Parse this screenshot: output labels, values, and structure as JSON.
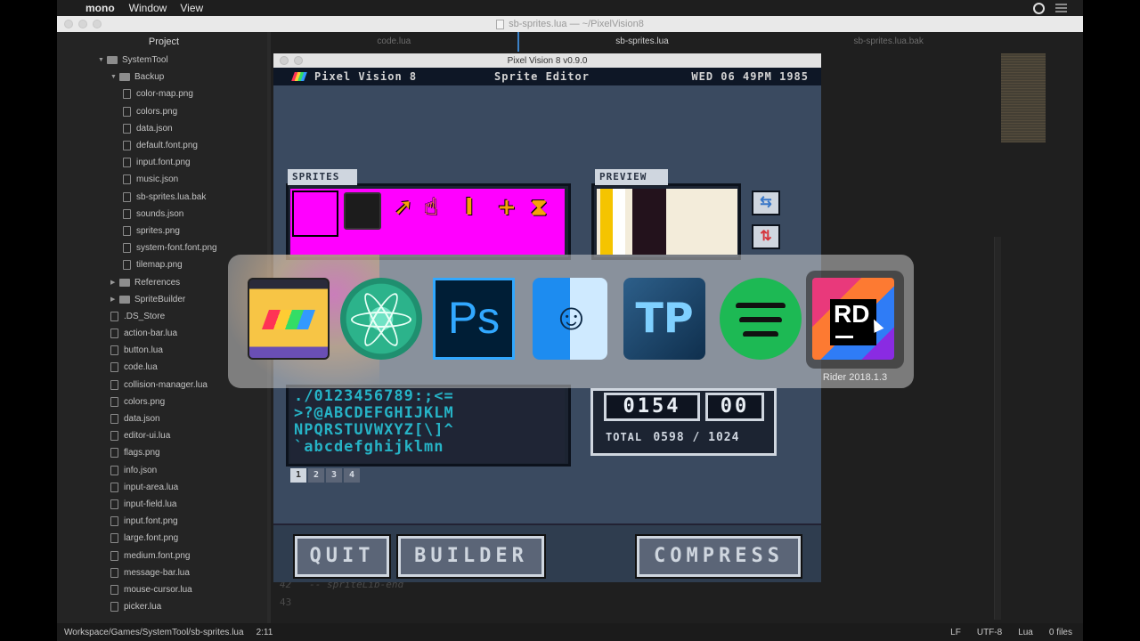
{
  "menubar": {
    "app_name": "mono",
    "items": [
      "Window",
      "View"
    ]
  },
  "window": {
    "title": "sb-sprites.lua — ~/PixelVision8"
  },
  "sidebar": {
    "header": "Project",
    "tree": [
      {
        "label": "SystemTool",
        "type": "folder",
        "depth": 0,
        "expanded": true
      },
      {
        "label": "Backup",
        "type": "folder",
        "depth": 1,
        "expanded": true
      },
      {
        "label": "color-map.png",
        "type": "file",
        "depth": 2
      },
      {
        "label": "colors.png",
        "type": "file",
        "depth": 2
      },
      {
        "label": "data.json",
        "type": "file",
        "depth": 2
      },
      {
        "label": "default.font.png",
        "type": "file",
        "depth": 2
      },
      {
        "label": "input.font.png",
        "type": "file",
        "depth": 2
      },
      {
        "label": "music.json",
        "type": "file",
        "depth": 2
      },
      {
        "label": "sb-sprites.lua.bak",
        "type": "file",
        "depth": 2
      },
      {
        "label": "sounds.json",
        "type": "file",
        "depth": 2
      },
      {
        "label": "sprites.png",
        "type": "file",
        "depth": 2
      },
      {
        "label": "system-font.font.png",
        "type": "file",
        "depth": 2
      },
      {
        "label": "tilemap.png",
        "type": "file",
        "depth": 2
      },
      {
        "label": "References",
        "type": "folder",
        "depth": 1,
        "expanded": false
      },
      {
        "label": "SpriteBuilder",
        "type": "folder",
        "depth": 1,
        "expanded": false
      },
      {
        "label": ".DS_Store",
        "type": "file",
        "depth": 1
      },
      {
        "label": "action-bar.lua",
        "type": "file",
        "depth": 1
      },
      {
        "label": "button.lua",
        "type": "file",
        "depth": 1
      },
      {
        "label": "code.lua",
        "type": "file",
        "depth": 1
      },
      {
        "label": "collision-manager.lua",
        "type": "file",
        "depth": 1
      },
      {
        "label": "colors.png",
        "type": "file",
        "depth": 1
      },
      {
        "label": "data.json",
        "type": "file",
        "depth": 1
      },
      {
        "label": "editor-ui.lua",
        "type": "file",
        "depth": 1
      },
      {
        "label": "flags.png",
        "type": "file",
        "depth": 1
      },
      {
        "label": "info.json",
        "type": "file",
        "depth": 1
      },
      {
        "label": "input-area.lua",
        "type": "file",
        "depth": 1
      },
      {
        "label": "input-field.lua",
        "type": "file",
        "depth": 1
      },
      {
        "label": "input.font.png",
        "type": "file",
        "depth": 1
      },
      {
        "label": "large.font.png",
        "type": "file",
        "depth": 1
      },
      {
        "label": "medium.font.png",
        "type": "file",
        "depth": 1
      },
      {
        "label": "message-bar.lua",
        "type": "file",
        "depth": 1
      },
      {
        "label": "mouse-cursor.lua",
        "type": "file",
        "depth": 1
      },
      {
        "label": "picker.lua",
        "type": "file",
        "depth": 1
      }
    ]
  },
  "tabs": [
    {
      "label": "code.lua",
      "active": false
    },
    {
      "label": "sb-sprites.lua",
      "active": true
    },
    {
      "label": "sb-sprites.lua.bak",
      "active": false
    }
  ],
  "code": {
    "line42_num": "42",
    "line42_text": "-- spriteLib-end",
    "line43_num": "43"
  },
  "statusbar": {
    "path": "Workspace/Games/SystemTool/sb-sprites.lua",
    "position": "2:11",
    "line_ending": "LF",
    "encoding": "UTF-8",
    "language": "Lua",
    "files": "0 files"
  },
  "pv8": {
    "window_title": "Pixel Vision 8 v0.9.0",
    "brand": "Pixel Vision 8",
    "tool_name": "Sprite Editor",
    "datetime": "WED 06 49PM 1985",
    "sprites_label": "SPRITES",
    "preview_label": "PREVIEW",
    "font_rows": [
      "./0123456789:;<=",
      ">?@ABCDEFGHIJKLM",
      "NPQRSTUVWXYZ[\\]^",
      "`abcdefghijklmn"
    ],
    "pages": [
      "1",
      "2",
      "3",
      "4"
    ],
    "active_page": "1",
    "sprite_id": "0154",
    "color_offset": "00",
    "total_label": "TOTAL",
    "total_value": "0598 / 1024",
    "buttons": {
      "quit": "QUIT",
      "builder": "BUILDER",
      "compress": "COMPRESS"
    }
  },
  "app_switcher": {
    "apps": [
      {
        "name": "Pixel Vision 8",
        "icon": "pv8-icon"
      },
      {
        "name": "Atom",
        "icon": "atom-icon"
      },
      {
        "name": "Photoshop",
        "icon": "photoshop-icon"
      },
      {
        "name": "Finder",
        "icon": "finder-icon"
      },
      {
        "name": "TexturePacker",
        "icon": "texturepacker-icon"
      },
      {
        "name": "Spotify",
        "icon": "spotify-icon"
      },
      {
        "name": "Rider",
        "icon": "rider-icon"
      }
    ],
    "selected_label": "Rider 2018.1.3"
  },
  "colors": {
    "accent_tab": "#3c82c8",
    "sprite_bg": "#ff00ff",
    "font_cyan": "#26b3c6"
  }
}
